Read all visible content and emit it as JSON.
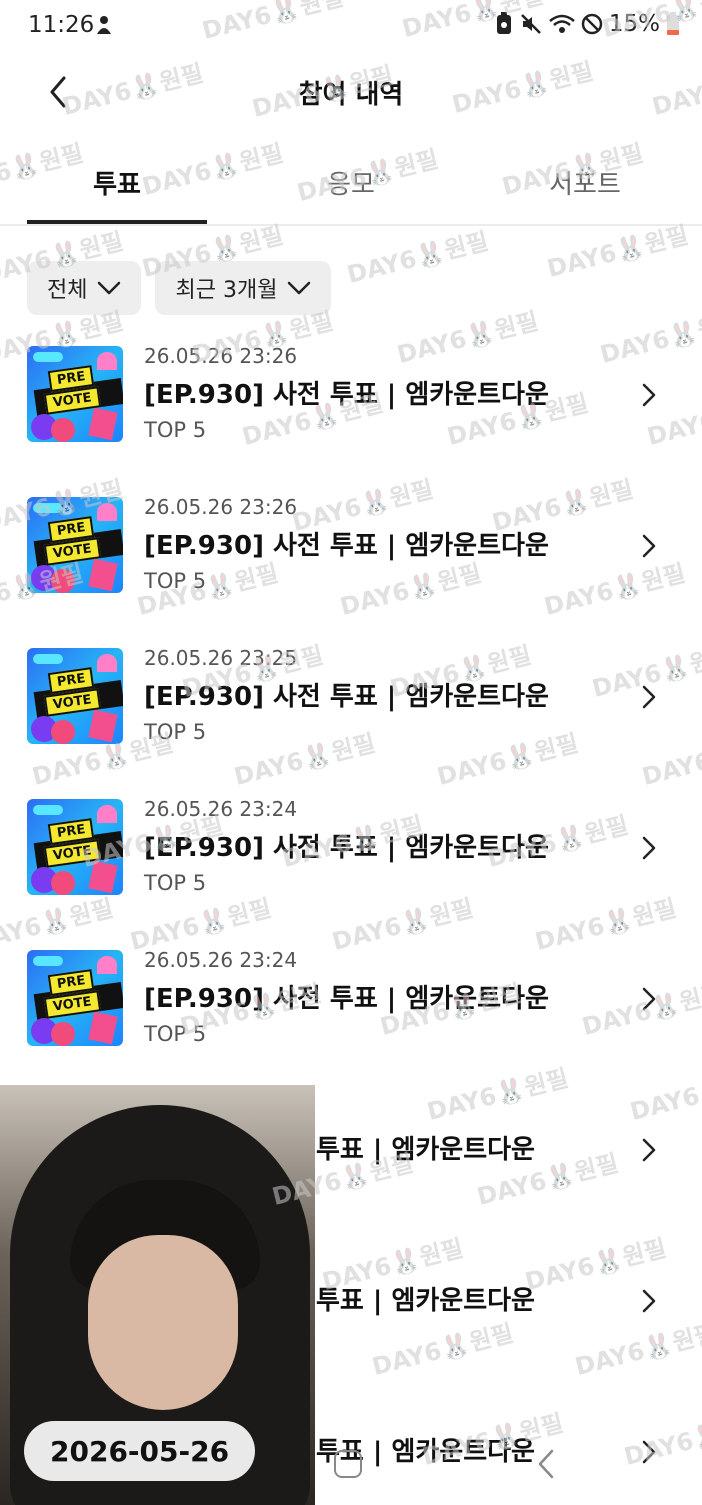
{
  "status_bar": {
    "time": "11:26",
    "battery_percent": "15%"
  },
  "header": {
    "title": "참여 내역"
  },
  "tabs": [
    {
      "label": "투표",
      "active": true
    },
    {
      "label": "응모",
      "active": false
    },
    {
      "label": "서포트",
      "active": false
    }
  ],
  "filters": {
    "scope": "전체",
    "period": "최근 3개월"
  },
  "thumbnail_text": {
    "line1": "PRE",
    "line2": "VOTE"
  },
  "items": [
    {
      "date": "26.05.26 23:26",
      "name": "[EP.930] 사전 투표 | 엠카운트다운",
      "sub": "TOP 5"
    },
    {
      "date": "26.05.26 23:26",
      "name": "[EP.930] 사전 투표 | 엠카운트다운",
      "sub": "TOP 5"
    },
    {
      "date": "26.05.26 23:25",
      "name": "[EP.930] 사전 투표 | 엠카운트다운",
      "sub": "TOP 5"
    },
    {
      "date": "26.05.26 23:24",
      "name": "[EP.930] 사전 투표 | 엠카운트다운",
      "sub": "TOP 5"
    },
    {
      "date": "26.05.26 23:24",
      "name": "[EP.930] 사전 투표 | 엠카운트다운",
      "sub": "TOP 5"
    },
    {
      "date": "",
      "name": "투표 | 엠카운트다운",
      "sub": ""
    },
    {
      "date": "",
      "name": "투표 | 엠카운트다운",
      "sub": ""
    },
    {
      "date": "",
      "name": "투표 | 엠카운트다운",
      "sub": ""
    }
  ],
  "overlay": {
    "date_label": "2026-05-26"
  },
  "watermark": "DAY6🐰원필",
  "icons": {
    "back": "chevron-left-icon",
    "dropdown": "chevron-down-icon",
    "row": "chevron-right-icon"
  }
}
